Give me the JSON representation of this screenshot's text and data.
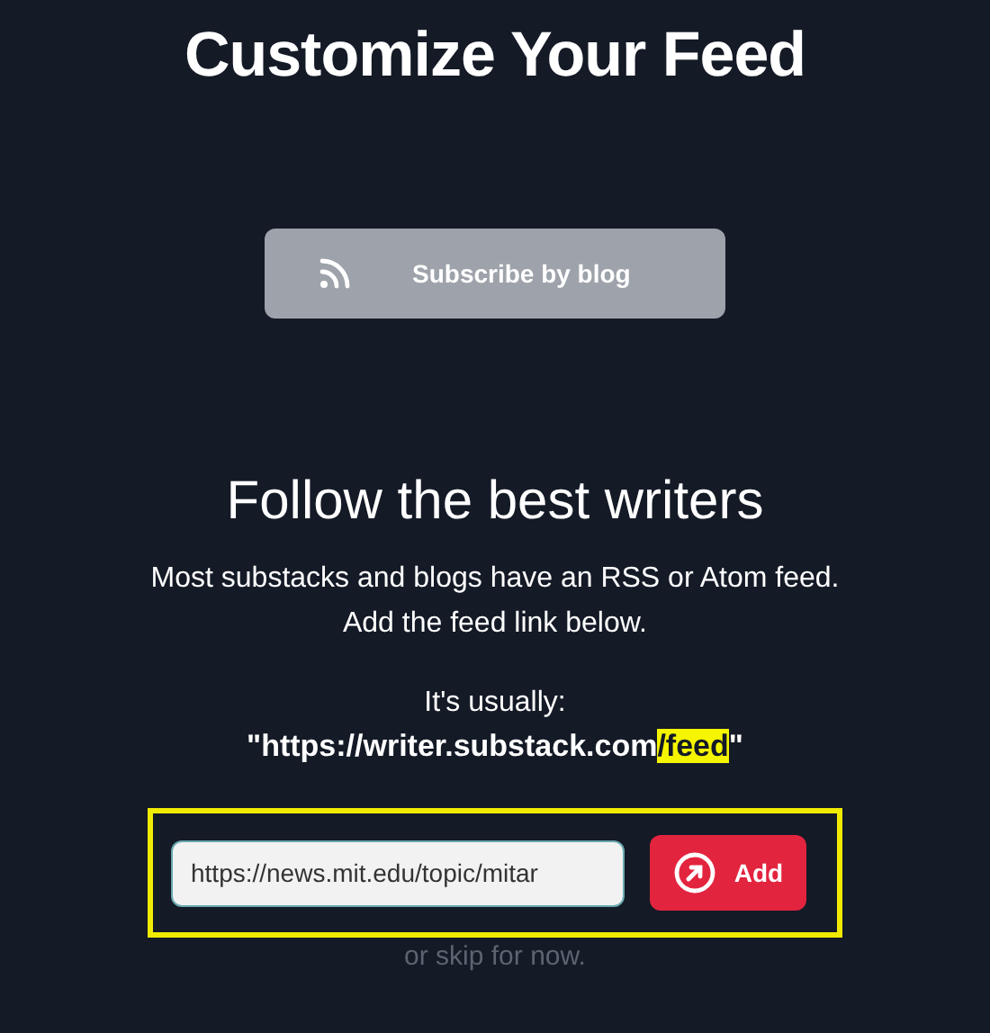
{
  "title": "Customize Your Feed",
  "subscribe_button": {
    "label": "Subscribe by blog"
  },
  "heading": "Follow the best writers",
  "description": [
    "Most substacks and blogs have an RSS or Atom feed.",
    "Add the feed link below."
  ],
  "hint": "It's usually:",
  "example": [
    {
      "text": "\"https://writer.substack.com",
      "highlighted": false
    },
    {
      "text": "/feed",
      "highlighted": true
    },
    {
      "text": "\"",
      "highlighted": false
    }
  ],
  "feed_field": {
    "value": "https://news.mit.edu/topic/mitar"
  },
  "add_button": {
    "label": "Add"
  },
  "skip_link": "or skip for now."
}
